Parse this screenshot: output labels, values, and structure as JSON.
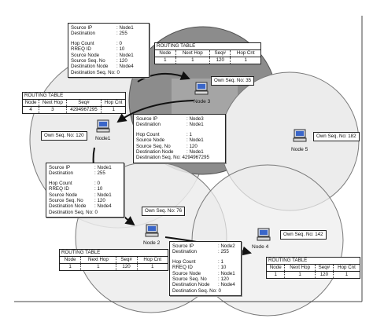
{
  "colors": {
    "circle_fill": "#ececec",
    "circle_stroke": "#7a7a7a",
    "dark_fill": "#8c8c8c",
    "rect_fill": "#a5a5a5",
    "box_border": "#222222"
  },
  "nodes": [
    {
      "label": "Node1"
    },
    {
      "label": "Node 2"
    },
    {
      "label": "Node 3"
    },
    {
      "label": "Node 4"
    },
    {
      "label": "Node 5"
    }
  ],
  "own_seq": {
    "node1": "Own Seq. No: 120",
    "node2": "Own Seq. No: 76",
    "node3": "Own Seq. No: 35",
    "node4": "Own Seq. No: 142",
    "node5": "Own Seq. No: 182"
  },
  "rreq_top": {
    "rows": [
      [
        "Source IP",
        ": Node1"
      ],
      [
        "Destination",
        ": 255"
      ],
      [
        "",
        ""
      ],
      [
        "Hop Count",
        ": 0"
      ],
      [
        "RREQ ID",
        ": 10"
      ],
      [
        "Source Node",
        ": Node1"
      ],
      [
        "Source Seq. No",
        ": 120"
      ],
      [
        "Destination Node",
        ": Node4"
      ],
      [
        "Destination Seq. No: 0",
        ""
      ]
    ]
  },
  "rrep_mid": {
    "rows": [
      [
        "Source IP",
        ": Node3"
      ],
      [
        "Destination",
        ": Node1"
      ],
      [
        "",
        ""
      ],
      [
        "Hop Count",
        ": 1"
      ],
      [
        "Source Node",
        ": Node1"
      ],
      [
        "Source Seq. No",
        ": 120"
      ],
      [
        "Destination Node",
        ": Node1"
      ],
      [
        "Destination Seq. No: 4294967295",
        ""
      ]
    ]
  },
  "rreq_left": {
    "rows": [
      [
        "Source IP",
        ": Node1"
      ],
      [
        "Destination",
        ": 255"
      ],
      [
        "",
        ""
      ],
      [
        "Hop Count",
        ": 0"
      ],
      [
        "RREQ ID",
        ": 10"
      ],
      [
        "Source Node",
        ": Node1"
      ],
      [
        "Source Seq. No",
        ": 120"
      ],
      [
        "Destination Node",
        ": Node4"
      ],
      [
        "Destination Seq. No: 0",
        ""
      ]
    ]
  },
  "rreq_bottom": {
    "rows": [
      [
        "Source IP",
        ": Node2"
      ],
      [
        "Destination",
        ": 255"
      ],
      [
        "",
        ""
      ],
      [
        "Hop Count",
        ": 1"
      ],
      [
        "RREQ ID",
        ": 10"
      ],
      [
        "Source Node",
        ": Node1"
      ],
      [
        "Source Seq. No",
        ": 120"
      ],
      [
        "Destination Node",
        ": Node4"
      ],
      [
        "Destination Seq. No: 0",
        ""
      ]
    ]
  },
  "rt_node1": {
    "title": "ROUTING TABLE",
    "headers": [
      "Node",
      "Next Hop",
      "Seq#",
      "Hop Cnt"
    ],
    "values": [
      "4",
      "3",
      "4294967295",
      "1"
    ]
  },
  "rt_node3": {
    "title": "ROUTING TABLE",
    "headers": [
      "Node",
      "Next Hop",
      "Seq#",
      "Hop Cnt"
    ],
    "values": [
      "1",
      "1",
      "120",
      "1"
    ]
  },
  "rt_node2": {
    "title": "ROUTING TABLE",
    "headers": [
      "Node",
      "Next Hop",
      "Seq#",
      "Hop Cnt"
    ],
    "values": [
      "1",
      "1",
      "120",
      "1"
    ]
  },
  "rt_node4": {
    "title": "ROUTING TABLE",
    "headers": [
      "Node",
      "Next Hop",
      "Seq#",
      "Hop Cnt"
    ],
    "values": [
      "1",
      "1",
      "120",
      "1"
    ]
  }
}
